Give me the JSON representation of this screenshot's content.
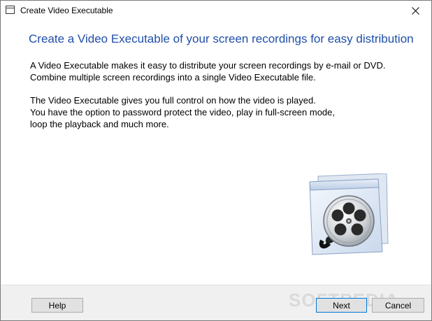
{
  "window": {
    "title": "Create Video Executable",
    "close_icon": "close-icon",
    "app_icon": "window-icon"
  },
  "main": {
    "heading": "Create a Video Executable of your screen recordings for easy distribution",
    "paragraph1": [
      "A Video Executable makes it easy to distribute your screen recordings by e-mail or DVD.",
      "Combine multiple screen recordings into a single Video Executable file."
    ],
    "paragraph2": [
      "The Video Executable gives you full control on how the video is played.",
      "You have the option to password protect the video, play in full-screen mode,",
      "loop the playback and much more."
    ],
    "illustration_icon": "film-reel-window-icon"
  },
  "footer": {
    "help_label": "Help",
    "next_label": "Next",
    "cancel_label": "Cancel",
    "watermark": "SOFTPEDIA"
  },
  "colors": {
    "heading": "#1f4fa8",
    "footer_bg": "#f0f0f0",
    "button_bg": "#e1e1e1",
    "default_button_border": "#0078d7"
  }
}
